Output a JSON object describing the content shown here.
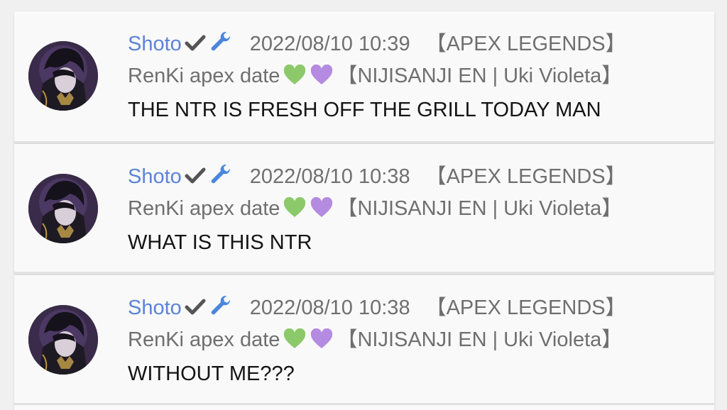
{
  "messages": [
    {
      "username": "Shoto",
      "timestamp": "2022/08/10 10:39",
      "game": "【APEX LEGENDS】",
      "stream_title": "RenKi apex date",
      "stream_suffix": "【NIJISANJI EN | Uki Violeta】",
      "text": "THE NTR IS FRESH OFF THE GRILL TODAY MAN"
    },
    {
      "username": "Shoto",
      "timestamp": "2022/08/10 10:38",
      "game": "【APEX LEGENDS】",
      "stream_title": "RenKi apex date",
      "stream_suffix": "【NIJISANJI EN | Uki Violeta】",
      "text": "WHAT IS THIS NTR"
    },
    {
      "username": "Shoto",
      "timestamp": "2022/08/10 10:38",
      "game": "【APEX LEGENDS】",
      "stream_title": "RenKi apex date",
      "stream_suffix": "【NIJISANJI EN | Uki Violeta】",
      "text": "WITHOUT ME???"
    }
  ],
  "icons": {
    "verified": "check-icon",
    "moderator": "wrench-icon",
    "heart_1": "green-heart-icon",
    "heart_2": "purple-heart-icon",
    "avatar": "avatar-icon"
  },
  "colors": {
    "username": "#5b84d6",
    "meta_text": "#6f6f6f",
    "message_text": "#141414",
    "green_heart": "#8cc96b",
    "purple_heart": "#b48be0",
    "wrench": "#4a86dc",
    "check": "#555555",
    "card_bg": "#f9f9f9",
    "page_bg": "#f0f0f0"
  }
}
